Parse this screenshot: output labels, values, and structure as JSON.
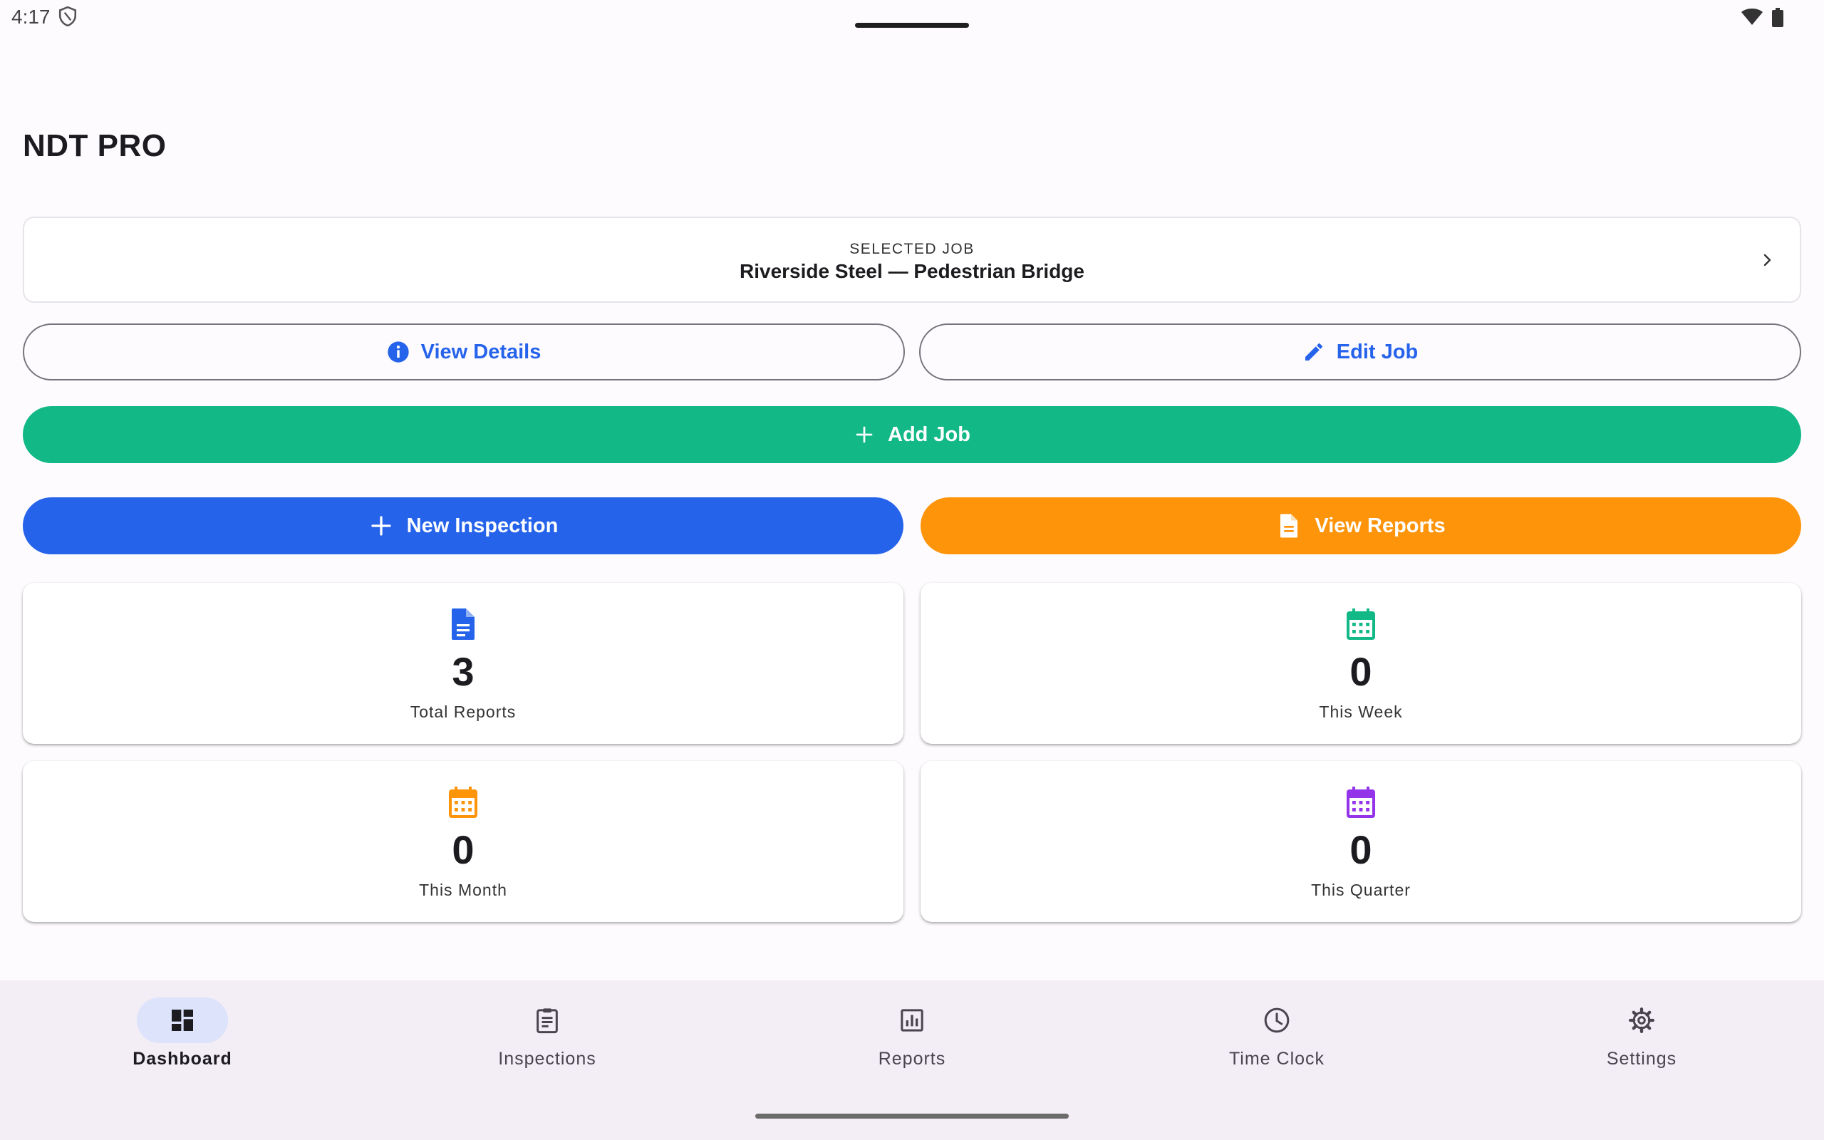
{
  "status_bar": {
    "time": "4:17",
    "icons": [
      "shield-icon",
      "wifi-icon",
      "battery-icon"
    ]
  },
  "app": {
    "title": "NDT PRO"
  },
  "selected_job": {
    "caption": "SELECTED JOB",
    "name": "Riverside Steel — Pedestrian Bridge",
    "icon": "chevron-right-icon"
  },
  "actions": {
    "view_details": {
      "label": "View Details",
      "icon": "info-icon",
      "color": "#2563eb"
    },
    "edit_job": {
      "label": "Edit Job",
      "icon": "pencil-icon",
      "color": "#2563eb"
    },
    "add_job": {
      "label": "Add Job",
      "icon": "plus-icon",
      "color": "#12b886"
    },
    "new_inspection": {
      "label": "New Inspection",
      "icon": "plus-icon",
      "color": "#2563eb"
    },
    "view_reports": {
      "label": "View Reports",
      "icon": "document-icon",
      "color": "#fd940a"
    }
  },
  "stats": [
    {
      "value": "3",
      "label": "Total Reports",
      "icon": "document-icon",
      "color": "#2563eb"
    },
    {
      "value": "0",
      "label": "This Week",
      "icon": "calendar-icon",
      "color": "#12b886"
    },
    {
      "value": "0",
      "label": "This Month",
      "icon": "calendar-icon",
      "color": "#fd940a"
    },
    {
      "value": "0",
      "label": "This Quarter",
      "icon": "calendar-icon",
      "color": "#9333ea"
    }
  ],
  "bottom_nav": {
    "items": [
      {
        "label": "Dashboard",
        "icon": "dashboard-icon",
        "active": true
      },
      {
        "label": "Inspections",
        "icon": "clipboard-icon",
        "active": false
      },
      {
        "label": "Reports",
        "icon": "bar-chart-icon",
        "active": false
      },
      {
        "label": "Time Clock",
        "icon": "clock-icon",
        "active": false
      },
      {
        "label": "Settings",
        "icon": "gear-icon",
        "active": false
      }
    ]
  }
}
